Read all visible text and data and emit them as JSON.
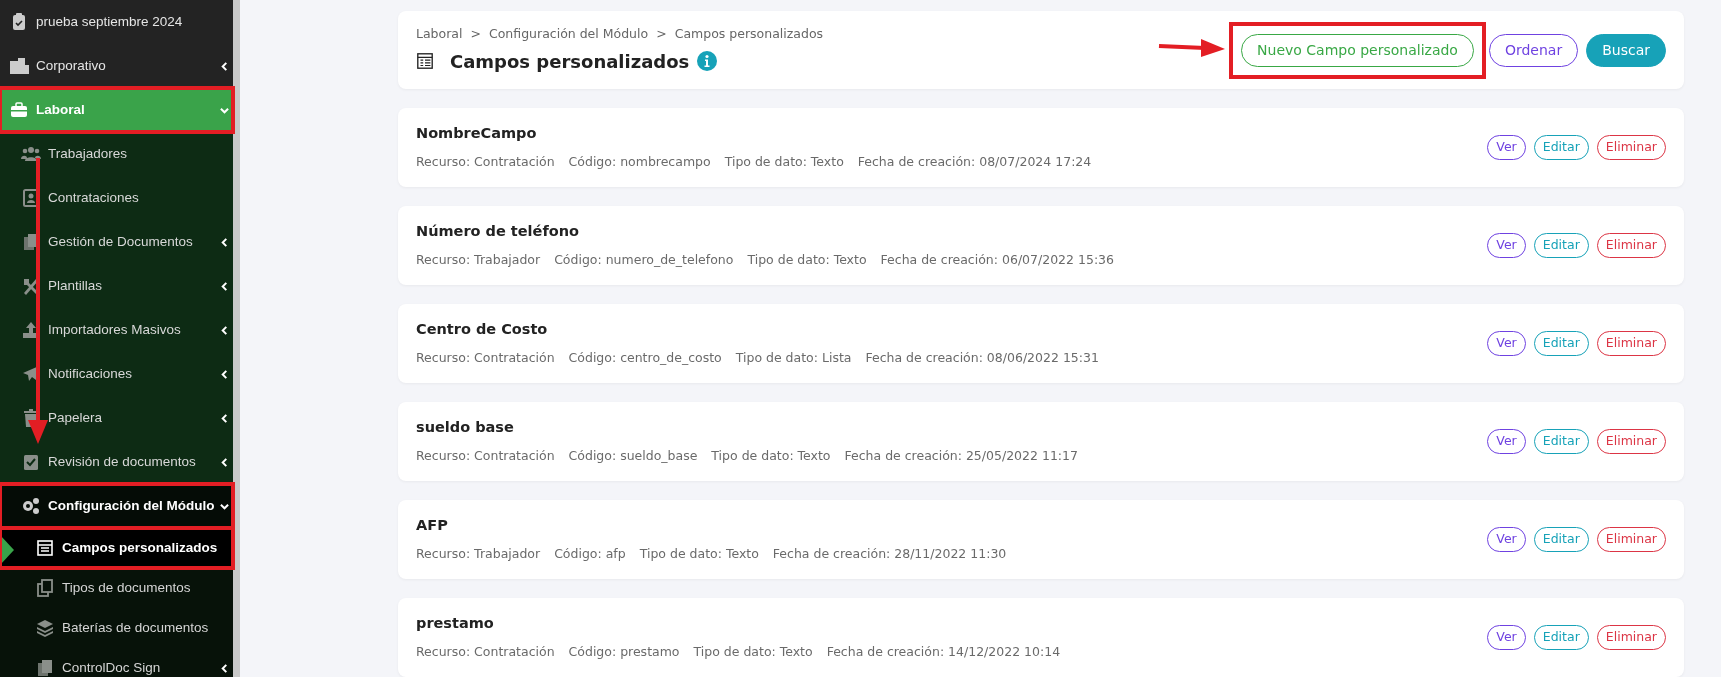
{
  "sidebar": {
    "items": [
      {
        "label": "prueba septiembre 2024",
        "selected": false
      },
      {
        "label": "Corporativo",
        "selected": false,
        "expanded": false
      },
      {
        "label": "Laboral",
        "selected": true,
        "expanded": true,
        "framed": true,
        "children": [
          {
            "label": "Trabajadores",
            "selected": false
          },
          {
            "label": "Contrataciones",
            "selected": false
          },
          {
            "label": "Gestión de Documentos",
            "selected": false,
            "expanded": false
          },
          {
            "label": "Plantillas",
            "selected": false,
            "expanded": false
          },
          {
            "label": "Importadores Masivos",
            "selected": false,
            "expanded": false
          },
          {
            "label": "Notificaciones",
            "selected": false,
            "expanded": false
          },
          {
            "label": "Papelera",
            "selected": false,
            "expanded": false
          },
          {
            "label": "Revisión de documentos",
            "selected": false,
            "expanded": false
          },
          {
            "label": "Configuración del Módulo",
            "selected": true,
            "expanded": true,
            "framed": true,
            "children": [
              {
                "label": "Campos personalizados",
                "selected": true,
                "framed": true
              },
              {
                "label": "Tipos de documentos",
                "selected": false
              },
              {
                "label": "Baterías de documentos",
                "selected": false
              },
              {
                "label": "ControlDoc Sign",
                "selected": false,
                "expanded": false
              }
            ]
          }
        ]
      }
    ]
  },
  "header": {
    "breadcrumb": [
      "Laboral",
      "Configuración del Módulo",
      "Campos personalizados"
    ],
    "breadcrumb_separators": [
      ">",
      ">"
    ],
    "title": "Campos personalizados",
    "buttons": [
      {
        "label": "Nuevo Campo personalizado",
        "kind": "success",
        "framed": true
      },
      {
        "label": "Ordenar",
        "kind": "indigo"
      },
      {
        "label": "Buscar",
        "kind": "info-solid"
      }
    ]
  },
  "fields": [
    {
      "name": "NombreCampo",
      "meta": [
        "Recurso: Contratación",
        "Código: nombrecampo",
        "Tipo de dato: Texto",
        "Fecha de creación: 08/07/2024 17:24"
      ],
      "actions": [
        "Ver",
        "Editar",
        "Eliminar"
      ]
    },
    {
      "name": "Número de teléfono",
      "meta": [
        "Recurso: Trabajador",
        "Código: numero_de_telefono",
        "Tipo de dato: Texto",
        "Fecha de creación: 06/07/2022 15:36"
      ],
      "actions": [
        "Ver",
        "Editar",
        "Eliminar"
      ]
    },
    {
      "name": "Centro de Costo",
      "meta": [
        "Recurso: Contratación",
        "Código: centro_de_costo",
        "Tipo de dato: Lista",
        "Fecha de creación: 08/06/2022 15:31"
      ],
      "actions": [
        "Ver",
        "Editar",
        "Eliminar"
      ]
    },
    {
      "name": "sueldo base",
      "meta": [
        "Recurso: Contratación",
        "Código: sueldo_base",
        "Tipo de dato: Texto",
        "Fecha de creación: 25/05/2022 11:17"
      ],
      "actions": [
        "Ver",
        "Editar",
        "Eliminar"
      ]
    },
    {
      "name": "AFP",
      "meta": [
        "Recurso: Trabajador",
        "Código: afp",
        "Tipo de dato: Texto",
        "Fecha de creación: 28/11/2022 11:30"
      ],
      "actions": [
        "Ver",
        "Editar",
        "Eliminar"
      ]
    },
    {
      "name": "prestamo",
      "meta": [
        "Recurso: Contratación",
        "Código: prestamo",
        "Tipo de dato: Texto",
        "Fecha de creación: 14/12/2022 10:14"
      ],
      "actions": [
        "Ver",
        "Editar",
        "Eliminar"
      ]
    }
  ]
}
